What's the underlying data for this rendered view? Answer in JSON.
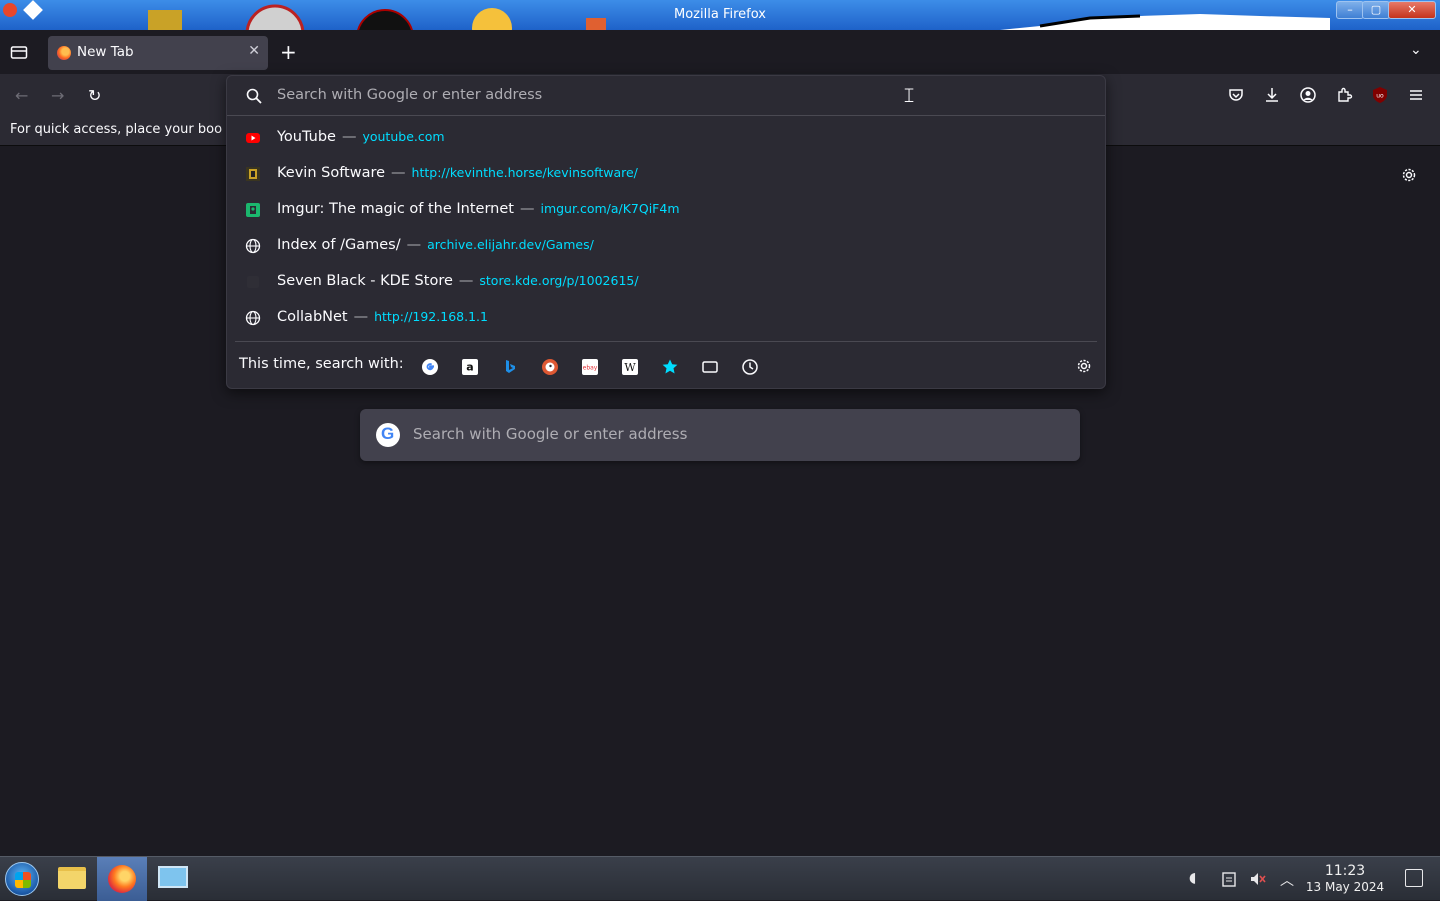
{
  "window": {
    "title": "Mozilla Firefox"
  },
  "tabs": [
    {
      "label": "New Tab",
      "close_glyph": "✕"
    }
  ],
  "tabstrip": {
    "new_tab_glyph": "+",
    "all_tabs_glyph": "⌄"
  },
  "nav": {
    "back_glyph": "←",
    "forward_glyph": "→",
    "reload_glyph": "↻"
  },
  "bookmarks_bar": {
    "hint": "For quick access, place your boo"
  },
  "urlbar": {
    "placeholder": "Search with Google or enter address",
    "results": [
      {
        "title": "YouTube",
        "url": "youtube.com",
        "icon": "youtube-icon"
      },
      {
        "title": "Kevin Software",
        "url": "http://kevinthe.horse/kevinsoftware/",
        "icon": "kevin-software-icon"
      },
      {
        "title": "Imgur: The magic of the Internet",
        "url": "imgur.com/a/K7QiF4m",
        "icon": "imgur-icon"
      },
      {
        "title": "Index of /Games/",
        "url": "archive.elijahr.dev/Games/",
        "icon": "globe-icon"
      },
      {
        "title": "Seven Black - KDE Store",
        "url": "store.kde.org/p/1002615/",
        "icon": "kde-store-icon"
      },
      {
        "title": "CollabNet",
        "url": "http://192.168.1.1",
        "icon": "globe-icon"
      }
    ],
    "separator": "—",
    "one_off_label": "This time, search with:",
    "engines": [
      "google",
      "amazon",
      "bing",
      "duckduckgo",
      "ebay",
      "wikipedia",
      "bookmarks",
      "tabs",
      "history"
    ]
  },
  "page": {
    "search_placeholder": "Search with Google or enter address",
    "google_letter": "G"
  },
  "taskbar": {
    "clock_time": "11:23",
    "clock_date": "13 May 2024"
  },
  "colors": {
    "accent": "#00ddff",
    "toolbar": "#2b2a33",
    "content": "#1c1b22"
  }
}
